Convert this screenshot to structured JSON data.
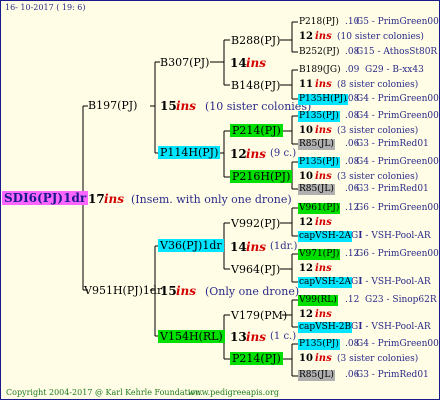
{
  "header": {
    "date": "16- 10-2017 ( 19:  6)"
  },
  "footer": {
    "copyright": "Copyright 2004-2017 @ Karl Kehrle Foundation.",
    "url": "www.pedigreeapis.org"
  },
  "colors": {
    "background": "#fffde6",
    "magenta": "#ff66ff",
    "cyan": "#00e5ff",
    "green": "#00e000",
    "gray": "#b0b0b0",
    "red": "#d40000",
    "navy": "#2b2b88",
    "darkgreen": "#1f7a1f"
  },
  "root": {
    "name": "SDI6(PJ)1dr"
  },
  "gen1": [
    {
      "name": "B197(PJ)",
      "num": "15",
      "ins": "ins",
      "note": "(10 sister colonies)"
    },
    {
      "num": "17",
      "ins": "ins",
      "note": "(Insem. with only one drone)"
    },
    {
      "name": "V951H(PJ)1dr",
      "num": "15",
      "ins": "ins",
      "note": "(Only one drone)"
    }
  ],
  "gen2": {
    "b307": {
      "name": "B307(PJ)",
      "num": "14",
      "ins": "ins"
    },
    "p114h": {
      "name": "P114H(PJ)",
      "num": "12",
      "ins": "ins",
      "note": "(9 c.)"
    },
    "v36": {
      "name": "V36(PJ)1dr",
      "num": "14",
      "ins": "ins",
      "note": "(1dr.)"
    },
    "v154h": {
      "name": "V154H(RL)",
      "num": "13",
      "ins": "ins",
      "note": "(1 c.)"
    }
  },
  "gen3": {
    "b288": {
      "name": "B288(PJ)"
    },
    "b148": {
      "name": "B148(PJ)"
    },
    "p214_1": {
      "name": "P214(PJ)"
    },
    "p216h": {
      "name": "P216H(PJ)"
    },
    "v992": {
      "name": "V992(PJ)",
      "num": "12",
      "ins": "ins"
    },
    "v964": {
      "name": "V964(PJ)",
      "num": "12",
      "ins": "ins"
    },
    "v179": {
      "name": "V179(PM)",
      "num": "12",
      "ins": "ins"
    },
    "p214_2": {
      "name": "P214(PJ)"
    }
  },
  "gen4": [
    {
      "name": "P218(PJ)",
      "code": ".10",
      "line": "G5 - PrimGreen00"
    },
    {
      "num": "12",
      "ins": "ins",
      "note": "(10 sister colonies)"
    },
    {
      "name": "B252(PJ)",
      "code": ".08",
      "line": "G15 - AthosSt80R"
    },
    {
      "name": "B189(JG)",
      "code": ".09",
      "line": "G29 - B-xx43"
    },
    {
      "num": "11",
      "ins": "ins",
      "note": "(8 sister colonies)"
    },
    {
      "name": "P135H(PJ)",
      "code": ".08",
      "line": "G4 - PrimGreen00"
    },
    {
      "name": "P135(PJ)",
      "code": ".08",
      "line": "G4 - PrimGreen00"
    },
    {
      "num": "10",
      "ins": "ins",
      "note": "(3 sister colonies)"
    },
    {
      "name": "R85(JL)",
      "code": ".06",
      "line": "G3 - PrimRed01"
    },
    {
      "name": "P135(PJ)",
      "code": ".08",
      "line": "G4 - PrimGreen00"
    },
    {
      "num": "10",
      "ins": "ins",
      "note": "(3 sister colonies)"
    },
    {
      "name": "R85(JL)",
      "code": ".06",
      "line": "G3 - PrimRed01"
    },
    {
      "name": "V961(PJ)",
      "code": ".12",
      "line": "G6 - PrimGreen00"
    },
    {
      "num": "12",
      "ins": "ins"
    },
    {
      "name": "capVSH-2A",
      "code": "GI",
      "line": "I - VSH-Pool-AR"
    },
    {
      "name": "V971(PJ)",
      "code": ".12",
      "line": "G6 - PrimGreen00"
    },
    {
      "num": "12",
      "ins": "ins"
    },
    {
      "name": "capVSH-2A",
      "code": "GI",
      "line": "I - VSH-Pool-AR"
    },
    {
      "name": "V99(RL)",
      "code": ".12",
      "line": "G23 - Sinop62R"
    },
    {
      "num": "12",
      "ins": "ins"
    },
    {
      "name": "capVSH-2B",
      "code": "GI",
      "line": "I - VSH-Pool-AR"
    },
    {
      "name": "P135(PJ)",
      "code": ".08",
      "line": "G4 - PrimGreen00"
    },
    {
      "num": "10",
      "ins": "ins",
      "note": "(3 sister colonies)"
    },
    {
      "name": "R85(JL)",
      "code": ".06",
      "line": "G3 - PrimRed01"
    }
  ]
}
